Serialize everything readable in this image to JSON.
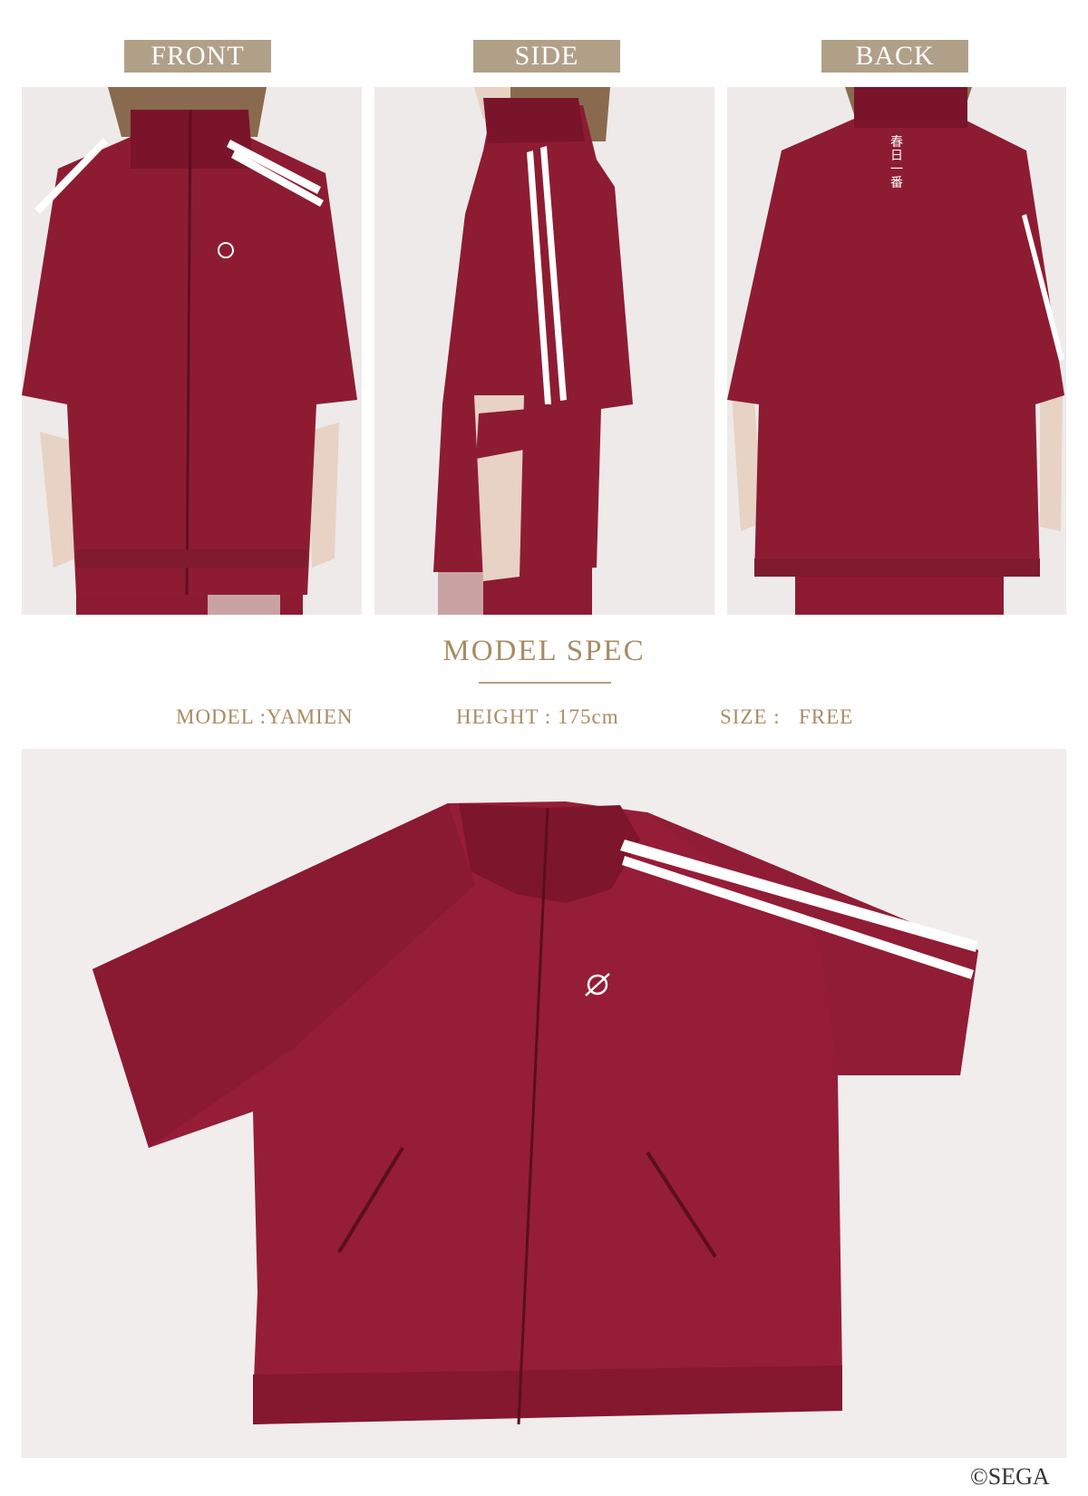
{
  "views": {
    "front": "FRONT",
    "side": "SIDE",
    "back": "BACK"
  },
  "back_embroidery": "春日一番",
  "model_spec": {
    "title": "MODEL SPEC",
    "model": "MODEL :YAMIEN",
    "height": "HEIGHT : 175cm",
    "size": "SIZE :   FREE"
  },
  "copyright": "©SEGA",
  "colors": {
    "label_bg": "#b1a088",
    "spec_text": "#a88c62",
    "jacket": "#8c1b32",
    "photo_bg": "#efeceb"
  }
}
